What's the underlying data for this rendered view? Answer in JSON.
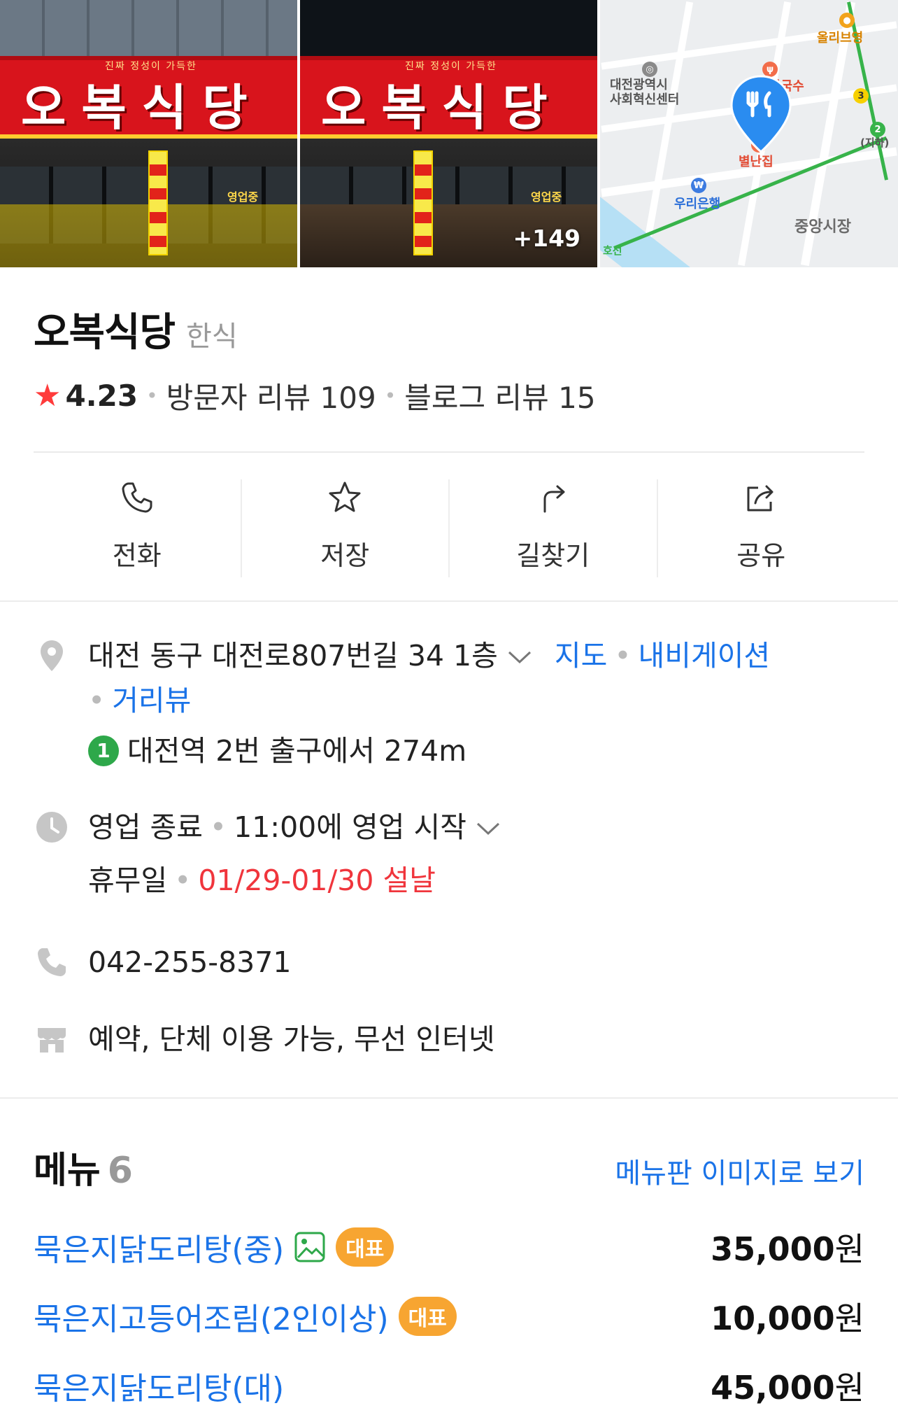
{
  "photos": {
    "more_count": "+149",
    "sign_text": "오복식당",
    "sign_small": "진짜 정성이 가득한",
    "open_tag": "영업중",
    "map_labels": {
      "olive": "올리브영",
      "center": "대전광역시\n사회혁신센터",
      "kalguksu": "칼국수",
      "byeolnan": "별난집",
      "woori": "우리은행",
      "jungang": "중앙시장",
      "underground": "(지하)",
      "line_label": "호선"
    }
  },
  "place": {
    "name": "오복식당",
    "category": "한식",
    "rating": "4.23",
    "visitor_reviews": "방문자 리뷰 109",
    "blog_reviews": "블로그 리뷰 15"
  },
  "actions": [
    {
      "label": "전화",
      "icon": "phone-icon"
    },
    {
      "label": "저장",
      "icon": "star-outline-icon"
    },
    {
      "label": "길찾기",
      "icon": "directions-arrow-icon"
    },
    {
      "label": "공유",
      "icon": "share-icon"
    }
  ],
  "info": {
    "address": "대전 동구 대전로807번길 34 1층",
    "map_link": "지도",
    "navigation_link": "내비게이션",
    "street_view_link": "거리뷰",
    "subway_line": "1",
    "subway_text": "대전역 2번 출구에서 274m",
    "status": "영업 종료",
    "open_time": "11:00에 영업 시작",
    "holiday_label": "휴무일",
    "holiday_dates": "01/29-01/30 설날",
    "phone": "042-255-8371",
    "amenities": "예약, 단체 이용 가능, 무선 인터넷"
  },
  "menu": {
    "title": "메뉴",
    "count": "6",
    "image_link": "메뉴판 이미지로 보기",
    "items": [
      {
        "name": "묵은지닭도리탕(중)",
        "has_image": true,
        "badge": "대표",
        "price": "35,000",
        "unit": "원"
      },
      {
        "name": "묵은지고등어조림(2인이상)",
        "has_image": false,
        "badge": "대표",
        "price": "10,000",
        "unit": "원"
      },
      {
        "name": "묵은지닭도리탕(대)",
        "has_image": false,
        "badge": "",
        "price": "45,000",
        "unit": "원"
      }
    ]
  },
  "colors": {
    "link": "#1a73e8",
    "rating_star": "#ff3b3b",
    "holiday": "#f0353c",
    "badge": "#f7a531",
    "subway_line1": "#2ea84a"
  }
}
